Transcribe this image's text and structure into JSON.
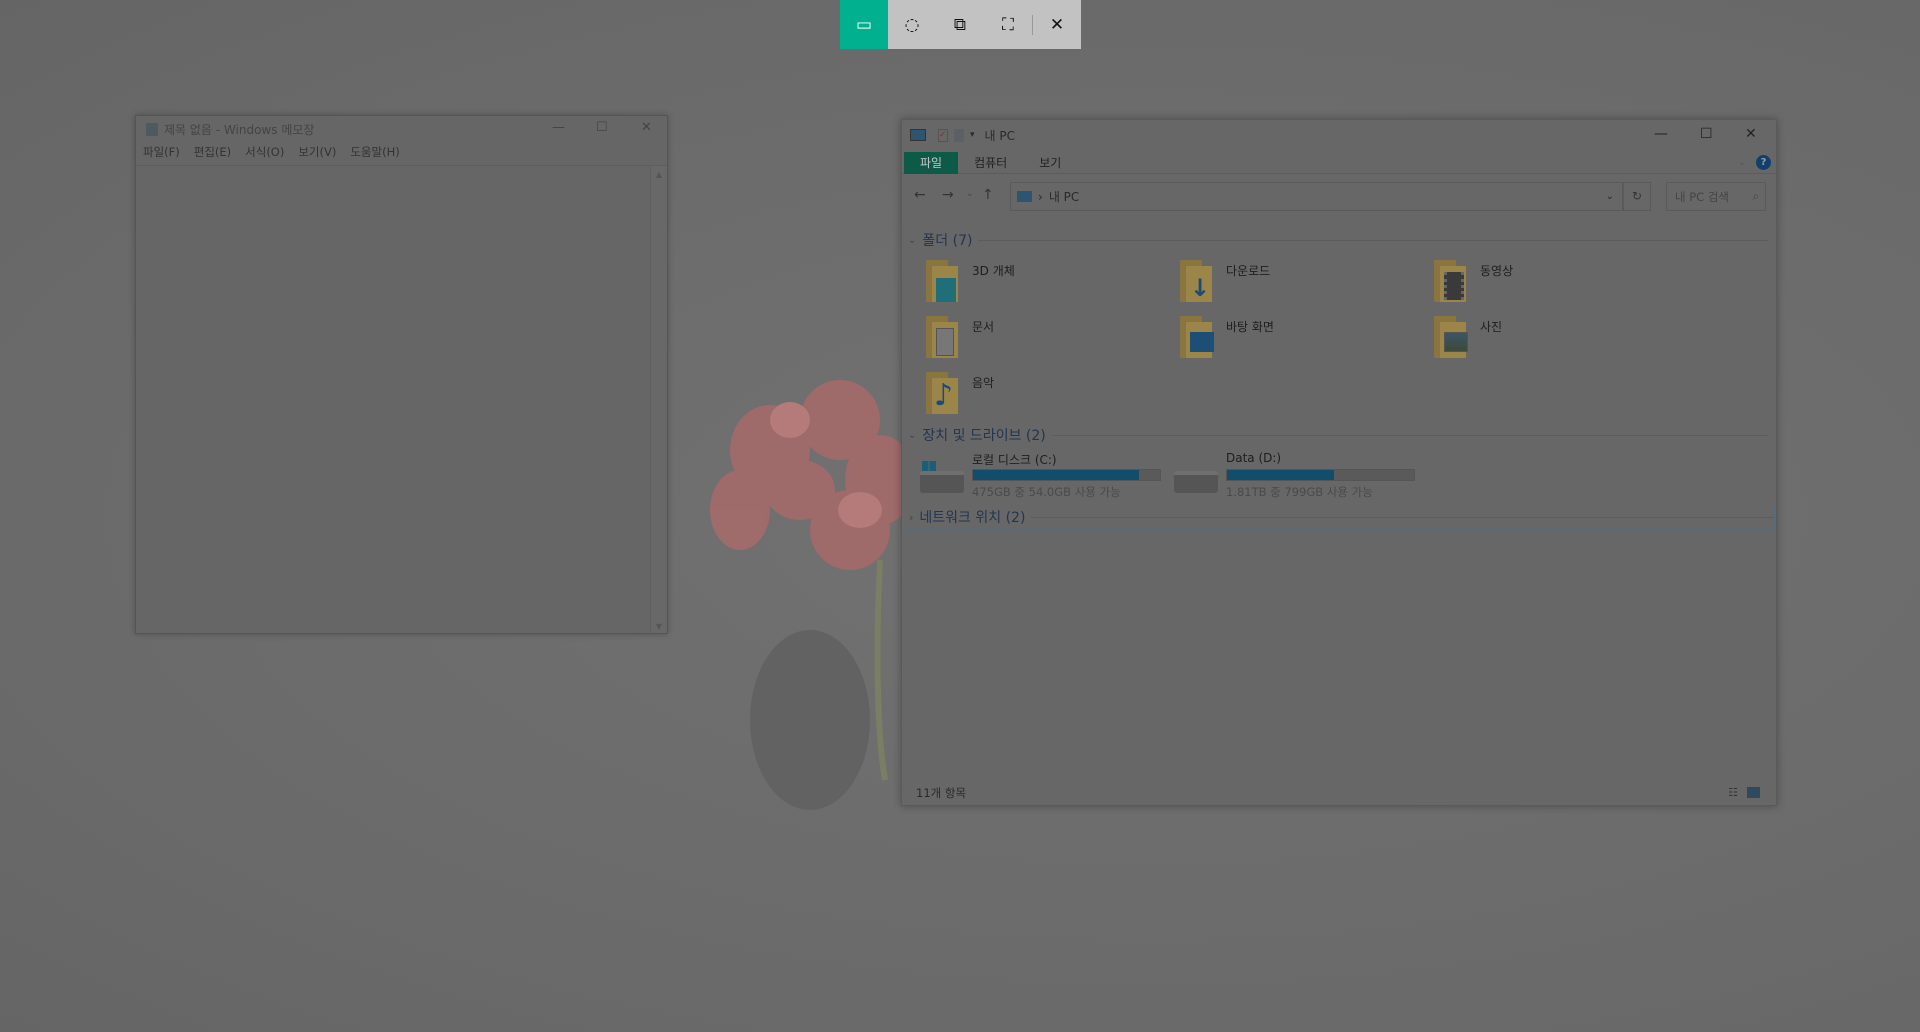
{
  "snip_toolbar": {
    "buttons": [
      {
        "name": "rectangular-snip",
        "active": true
      },
      {
        "name": "freeform-snip"
      },
      {
        "name": "window-snip"
      },
      {
        "name": "fullscreen-snip"
      },
      {
        "name": "close"
      }
    ],
    "accent": "#00b08f"
  },
  "notepad": {
    "title": "제목 없음 - Windows 메모장",
    "menu": [
      "파일(F)",
      "편집(E)",
      "서식(O)",
      "보기(V)",
      "도움말(H)"
    ]
  },
  "explorer": {
    "title": "내 PC",
    "tabs": [
      "파일",
      "컴퓨터",
      "보기"
    ],
    "address": "내 PC",
    "search_placeholder": "내 PC 검색",
    "folders_header": "폴더 (7)",
    "folders": [
      "3D 개체",
      "다운로드",
      "동영상",
      "문서",
      "바탕 화면",
      "사진",
      "음악"
    ],
    "devices_header": "장치 및 드라이브 (2)",
    "drives": [
      {
        "name": "로컬 디스크 (C:)",
        "info": "475GB 중 54.0GB 사용 가능",
        "used_fraction": 0.89
      },
      {
        "name": "Data (D:)",
        "info": "1.81TB 중 799GB 사용 가능",
        "used_fraction": 0.57
      }
    ],
    "network_header": "네트워크 위치 (2)",
    "status": "11개 항목",
    "accent": "#0e5a48"
  }
}
